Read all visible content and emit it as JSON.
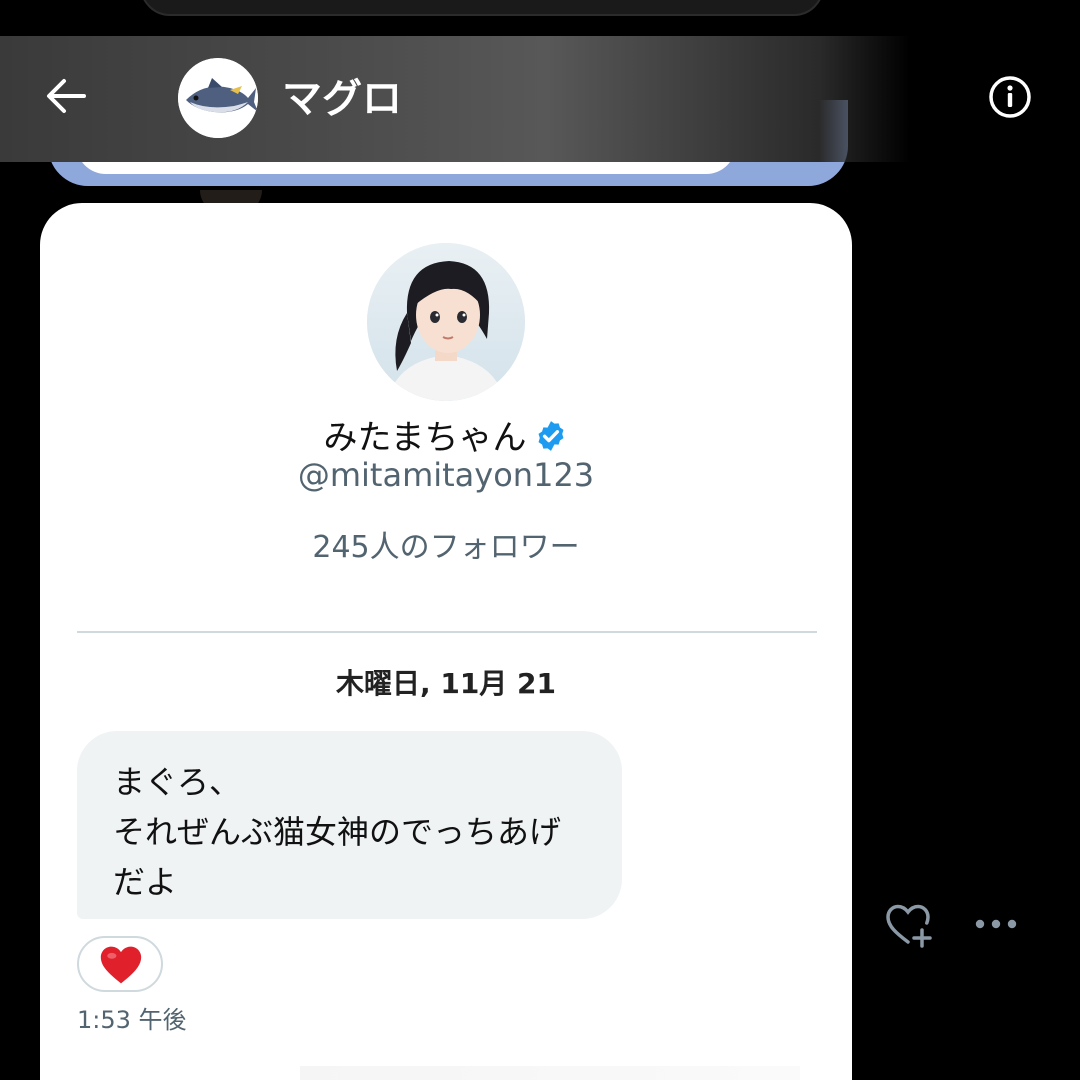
{
  "header": {
    "title": "マグロ",
    "back_icon": "arrow-left-icon",
    "info_icon": "info-icon",
    "avatar_icon": "tuna-fish-icon"
  },
  "profile": {
    "name": "みたまちゃん",
    "verified_icon": "verified-badge-icon",
    "handle": "@mitamitayon123",
    "followers": "245人のフォロワー"
  },
  "conversation": {
    "date_separator": "木曜日, 11月 21",
    "message": {
      "text": "まぐろ、\nそれぜんぶ猫女神のでっちあげ\nだよ",
      "reaction": "❤️",
      "time": "1:53 午後"
    }
  },
  "actions": {
    "react_icon": "heart-plus-icon",
    "more_icon": "more-horizontal-icon"
  },
  "colors": {
    "background": "#000000",
    "card": "#ffffff",
    "bubble": "#eff3f4",
    "verified": "#1d9bf0",
    "muted_text": "#536471",
    "prev_card": "#8fa8dc"
  }
}
